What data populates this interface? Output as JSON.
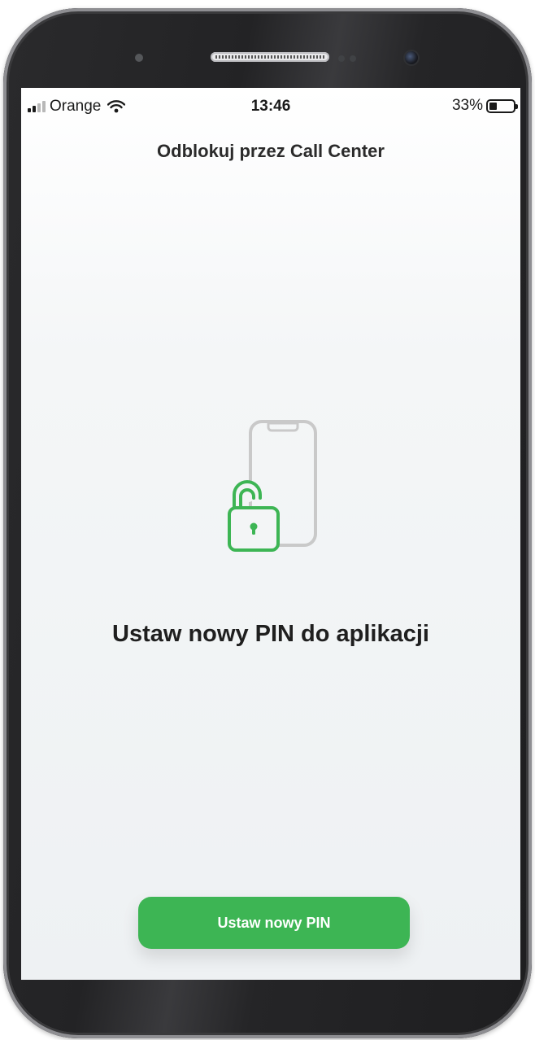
{
  "status_bar": {
    "carrier": "Orange",
    "time": "13:46",
    "battery_text": "33%",
    "battery_level": 0.33
  },
  "header": {
    "title": "Odblokuj przez Call Center"
  },
  "main": {
    "illustration_icon": "unlocked-padlock-phone-icon",
    "message": "Ustaw nowy PIN do aplikacji"
  },
  "actions": {
    "primary_label": "Ustaw nowy PIN"
  },
  "colors": {
    "accent": "#3db554",
    "illustration_stroke": "#3db554",
    "phone_outline": "#c9c9c9"
  }
}
